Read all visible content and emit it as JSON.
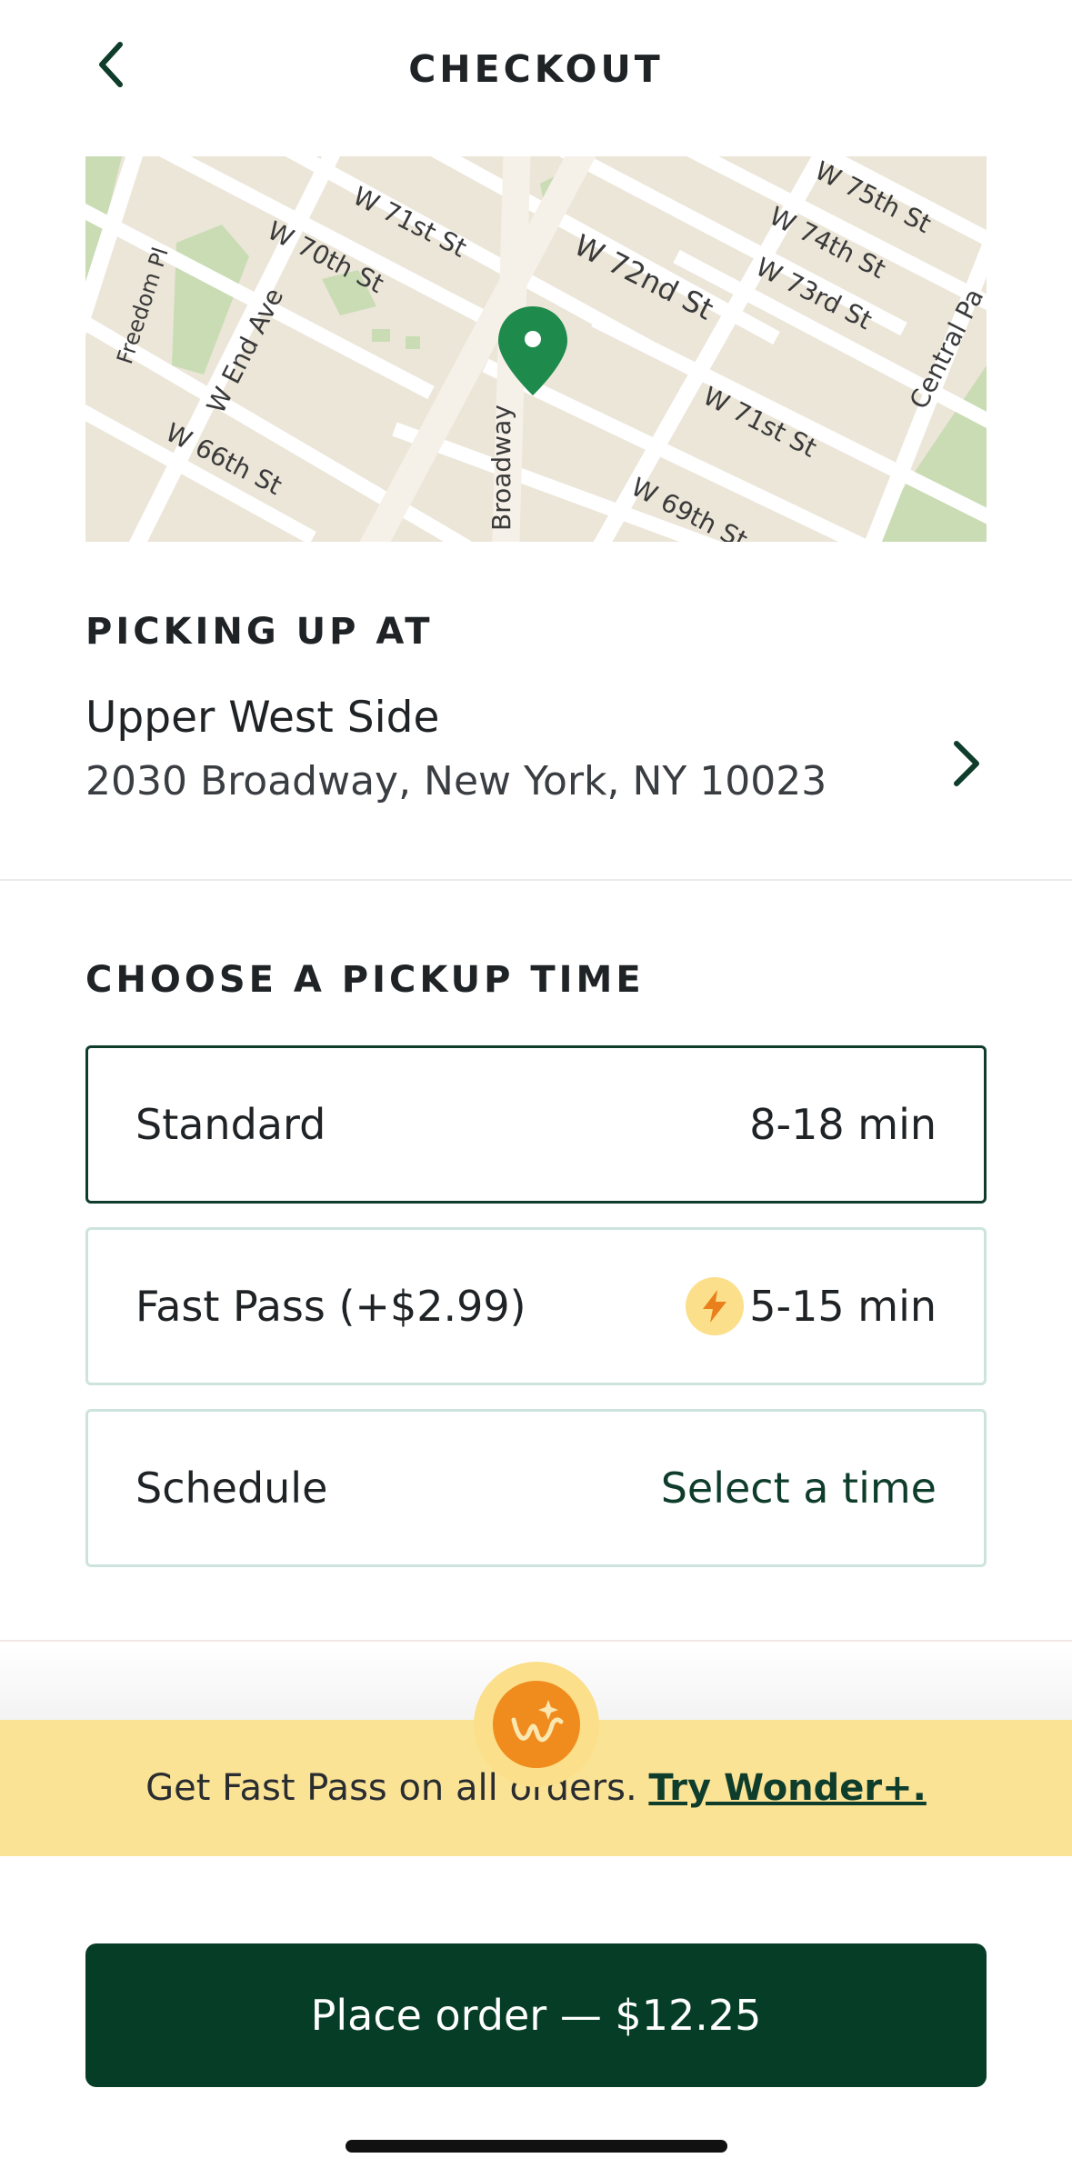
{
  "header": {
    "title": "CHECKOUT",
    "back_icon": "chevron-left-icon"
  },
  "map": {
    "streets": [
      "W 75th St",
      "W 74th St",
      "W 73rd St",
      "W 72nd St",
      "W 71st St",
      "W 71st St",
      "W 70th St",
      "W 69th St",
      "W 66th St",
      "W End Ave",
      "Freedom Pl",
      "Broadway",
      "Central Pa"
    ],
    "pin_icon": "map-pin-icon",
    "pin_color": "#1e8a4c"
  },
  "pickup": {
    "section_label": "PICKING UP AT",
    "store_name": "Upper West Side",
    "store_address": "2030 Broadway, New York, NY 10023"
  },
  "pickup_time": {
    "section_label": "CHOOSE A PICKUP TIME",
    "options": [
      {
        "label": "Standard",
        "value": "8-18 min",
        "selected": true
      },
      {
        "label": "Fast Pass (+$2.99)",
        "value": "5-15 min",
        "icon": "lightning-bolt-icon"
      },
      {
        "label": "Schedule",
        "value": "Select a time"
      }
    ]
  },
  "promo": {
    "text": "Get Fast Pass on all orders.",
    "link": "Try Wonder+.",
    "badge_icon": "wonder-plus-logo-icon"
  },
  "checkout": {
    "place_order_label": "Place order — $12.25"
  },
  "colors": {
    "brand_green": "#053d26",
    "selected_border": "#0f3d2b",
    "promo_yellow": "#fbe396",
    "accent_orange": "#ef8c1d"
  }
}
